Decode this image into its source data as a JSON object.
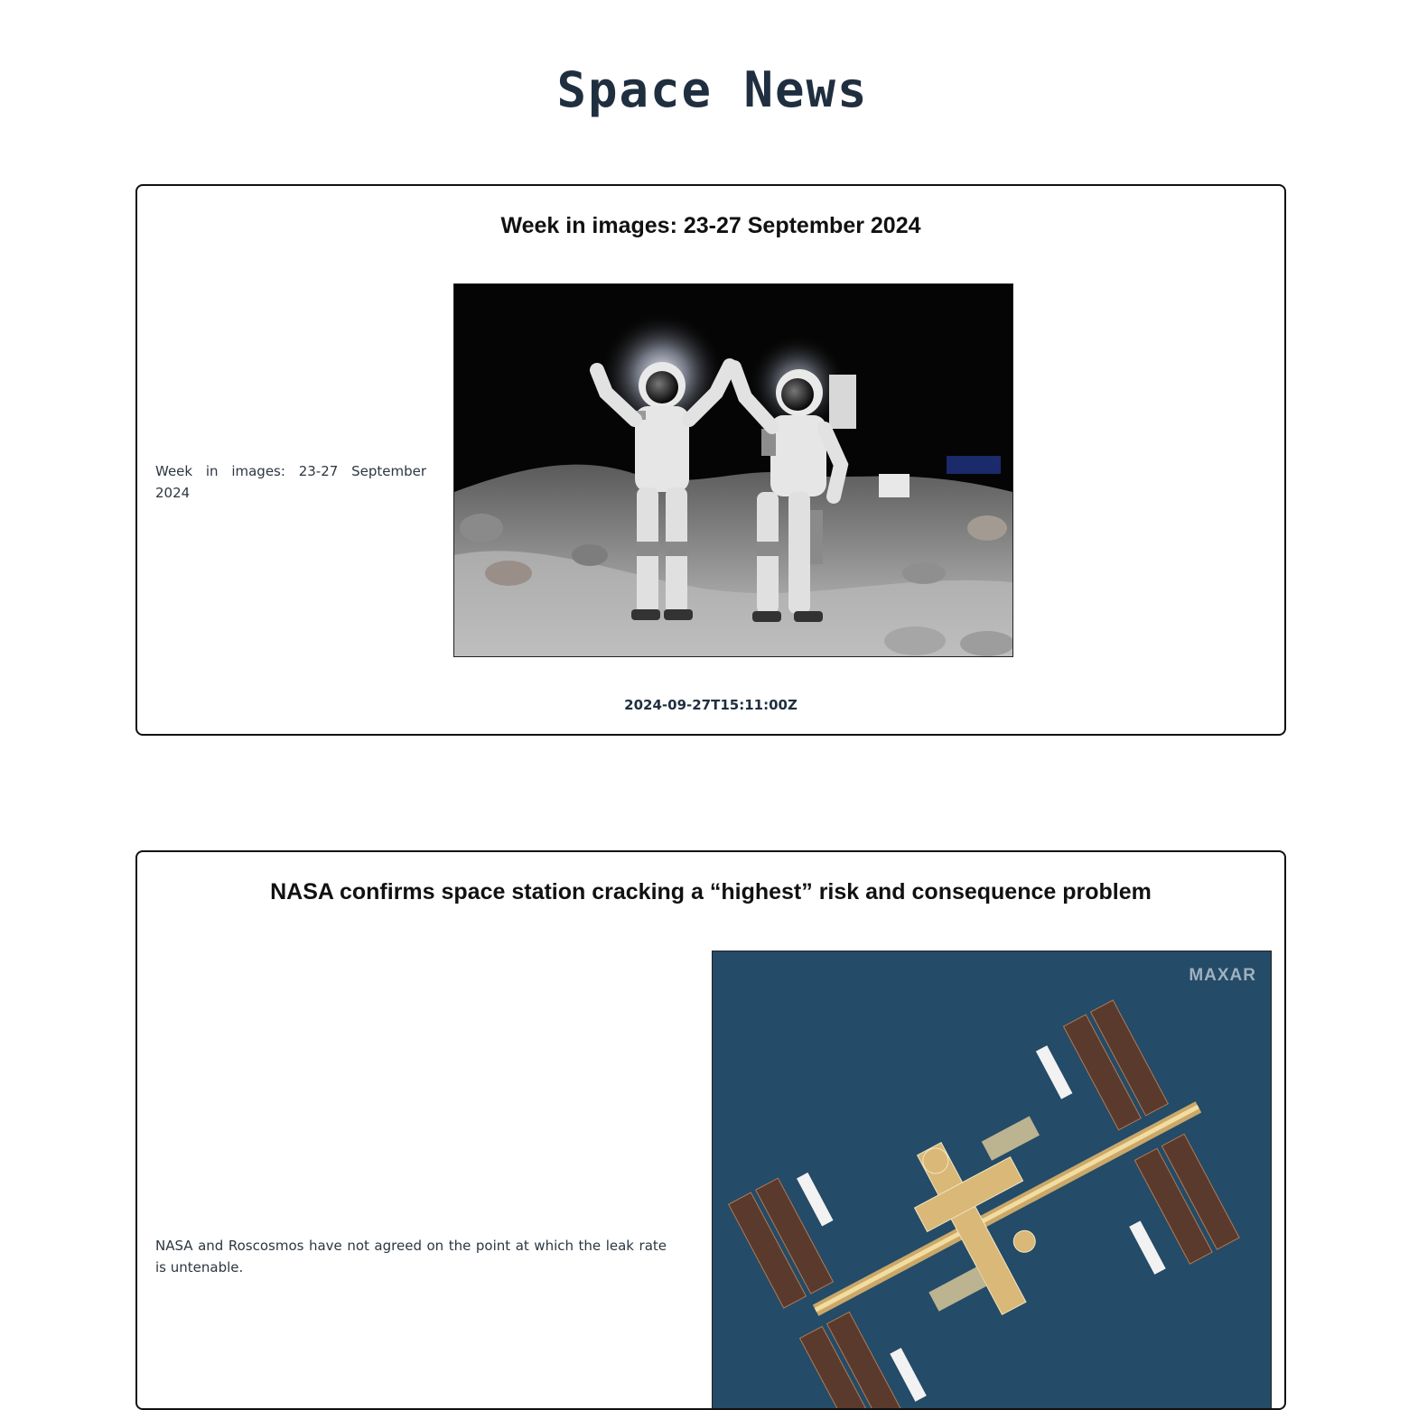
{
  "header": {
    "title": "Space News"
  },
  "articles": [
    {
      "title": "Week in images: 23-27 September 2024",
      "description": "Week in images: 23-27 September 2024",
      "date": "2024-09-27T15:11:00Z",
      "image": "astronauts-in-lunar-suits-photo"
    },
    {
      "title": "NASA confirms space station cracking a “highest” risk and consequence problem",
      "description": "NASA and Roscosmos have not agreed on the point at which the leak rate is untenable.",
      "image": "space-station-satellite-photo",
      "image_watermark": "MAXAR"
    }
  ]
}
